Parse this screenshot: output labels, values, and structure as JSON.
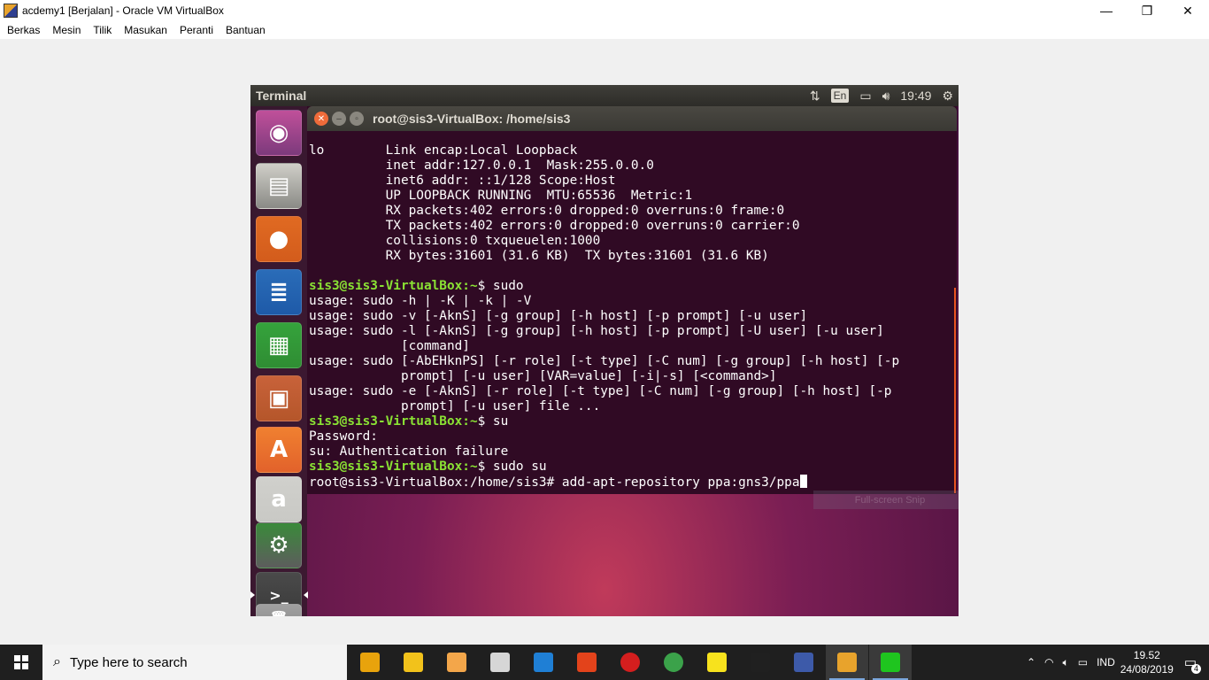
{
  "window": {
    "title": "acdemy1 [Berjalan] - Oracle VM VirtualBox",
    "minimize": "—",
    "restore": "❐",
    "close": "✕"
  },
  "menu": [
    "Berkas",
    "Mesin",
    "Tilik",
    "Masukan",
    "Peranti",
    "Bantuan"
  ],
  "guest_panel": {
    "title": "Terminal",
    "lang": "En",
    "time": "19:49"
  },
  "launcher": [
    {
      "name": "ubuntu-dash-icon",
      "bg": "#7c3a7c",
      "glyph": "◉"
    },
    {
      "name": "files-icon",
      "bg": "#8a8a86",
      "glyph": "▤"
    },
    {
      "name": "firefox-icon",
      "bg": "#d35c1c",
      "glyph": "●"
    },
    {
      "name": "libreoffice-writer-icon",
      "bg": "#1e5aa8",
      "glyph": "≣"
    },
    {
      "name": "libreoffice-calc-icon",
      "bg": "#2f8d33",
      "glyph": "▦"
    },
    {
      "name": "libreoffice-impress-icon",
      "bg": "#b5562a",
      "glyph": "▣"
    },
    {
      "name": "software-center-icon",
      "bg": "#e2622b",
      "glyph": "A"
    },
    {
      "name": "amazon-icon",
      "bg": "#c9c9c5",
      "glyph": "a"
    },
    {
      "name": "system-settings-icon",
      "bg": "#5d5d5d",
      "glyph": "⚙"
    },
    {
      "name": "terminal-launcher-icon",
      "bg": "#3a3a3a",
      "glyph": ">_"
    },
    {
      "name": "trash-icon",
      "bg": "#8c8c8c",
      "glyph": "🗑"
    }
  ],
  "terminal": {
    "title": "root@sis3-VirtualBox: /home/sis3",
    "lines": [
      {
        "text": "lo        Link encap:Local Loopback"
      },
      {
        "text": "          inet addr:127.0.0.1  Mask:255.0.0.0"
      },
      {
        "text": "          inet6 addr: ::1/128 Scope:Host"
      },
      {
        "text": "          UP LOOPBACK RUNNING  MTU:65536  Metric:1"
      },
      {
        "text": "          RX packets:402 errors:0 dropped:0 overruns:0 frame:0"
      },
      {
        "text": "          TX packets:402 errors:0 dropped:0 overruns:0 carrier:0"
      },
      {
        "text": "          collisions:0 txqueuelen:1000"
      },
      {
        "text": "          RX bytes:31601 (31.6 KB)  TX bytes:31601 (31.6 KB)"
      },
      {
        "text": ""
      },
      {
        "prompt": "sis3@sis3-VirtualBox:~",
        "text": "$ sudo"
      },
      {
        "text": "usage: sudo -h | -K | -k | -V"
      },
      {
        "text": "usage: sudo -v [-AknS] [-g group] [-h host] [-p prompt] [-u user]"
      },
      {
        "text": "usage: sudo -l [-AknS] [-g group] [-h host] [-p prompt] [-U user] [-u user]"
      },
      {
        "text": "            [command]"
      },
      {
        "text": "usage: sudo [-AbEHknPS] [-r role] [-t type] [-C num] [-g group] [-h host] [-p"
      },
      {
        "text": "            prompt] [-u user] [VAR=value] [-i|-s] [<command>]"
      },
      {
        "text": "usage: sudo -e [-AknS] [-r role] [-t type] [-C num] [-g group] [-h host] [-p"
      },
      {
        "text": "            prompt] [-u user] file ..."
      },
      {
        "prompt": "sis3@sis3-VirtualBox:~",
        "text": "$ su"
      },
      {
        "text": "Password:"
      },
      {
        "text": "su: Authentication failure"
      },
      {
        "prompt": "sis3@sis3-VirtualBox:~",
        "text": "$ sudo su"
      },
      {
        "text": "root@sis3-VirtualBox:/home/sis3# add-apt-repository ppa:gns3/ppa",
        "cursor": true
      }
    ]
  },
  "snip_overlay": "Full-screen Snip",
  "taskbar": {
    "search_placeholder": "Type here to search",
    "apps": [
      {
        "name": "microsoft-store-icon",
        "color": "#e8a30c"
      },
      {
        "name": "file-explorer-icon",
        "color": "#f2c21b"
      },
      {
        "name": "media-player-icon",
        "color": "#f3a64a"
      },
      {
        "name": "paint-icon",
        "color": "#d6d6d6"
      },
      {
        "name": "edge-icon",
        "color": "#1f7fd5"
      },
      {
        "name": "office-icon",
        "color": "#e3431b"
      },
      {
        "name": "record-icon",
        "color": "#d41e1e"
      },
      {
        "name": "chrome-icon",
        "color": "#3ba24a"
      },
      {
        "name": "sticky-notes-icon",
        "color": "#f7e21d"
      },
      {
        "name": "cmd-icon",
        "color": "#202020"
      },
      {
        "name": "virtualbox-icon",
        "color": "#3d5aa9"
      },
      {
        "name": "virtualbox-vm-icon",
        "color": "#e8a32c",
        "active": true
      },
      {
        "name": "line-icon",
        "color": "#1fc51f",
        "active": true
      }
    ],
    "lang": "IND",
    "time": "19.52",
    "date": "24/08/2019",
    "notifications": "4"
  }
}
